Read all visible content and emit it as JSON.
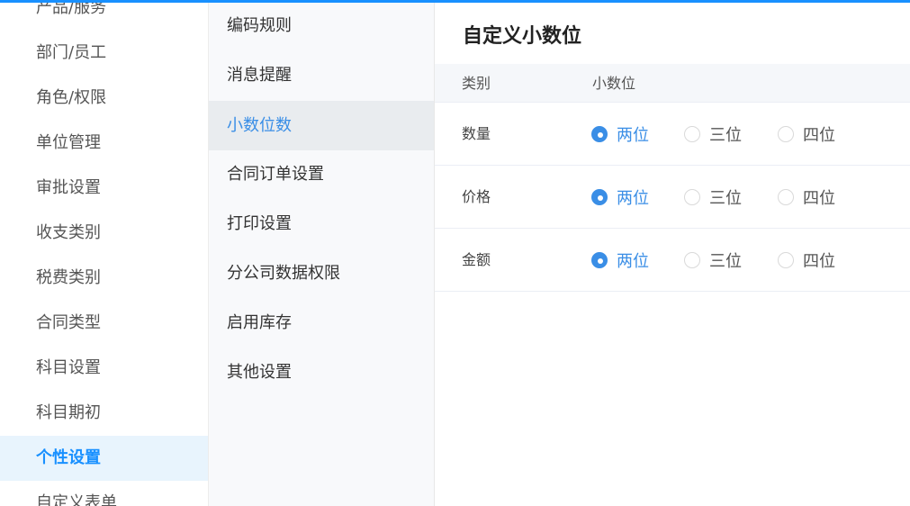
{
  "colors": {
    "accent": "#1890ff",
    "selected": "#3a8ee6"
  },
  "nav_left": {
    "items": [
      {
        "label": "产品/服务"
      },
      {
        "label": "部门/员工"
      },
      {
        "label": "角色/权限"
      },
      {
        "label": "单位管理"
      },
      {
        "label": "审批设置"
      },
      {
        "label": "收支类别"
      },
      {
        "label": "税费类别"
      },
      {
        "label": "合同类型"
      },
      {
        "label": "科目设置"
      },
      {
        "label": "科目期初"
      },
      {
        "label": "个性设置",
        "active": true
      },
      {
        "label": "自定义表单"
      }
    ]
  },
  "nav_mid": {
    "items": [
      {
        "label": "编码规则"
      },
      {
        "label": "消息提醒"
      },
      {
        "label": "小数位数",
        "active": true
      },
      {
        "label": "合同订单设置"
      },
      {
        "label": "打印设置"
      },
      {
        "label": "分公司数据权限"
      },
      {
        "label": "启用库存"
      },
      {
        "label": "其他设置"
      }
    ]
  },
  "main": {
    "title": "自定义小数位",
    "table": {
      "headers": [
        "类别",
        "小数位"
      ],
      "rows": [
        {
          "label": "数量",
          "options": [
            "两位",
            "三位",
            "四位"
          ],
          "selected": "两位"
        },
        {
          "label": "价格",
          "options": [
            "两位",
            "三位",
            "四位"
          ],
          "selected": "两位"
        },
        {
          "label": "金额",
          "options": [
            "两位",
            "三位",
            "四位"
          ],
          "selected": "两位"
        }
      ]
    }
  }
}
